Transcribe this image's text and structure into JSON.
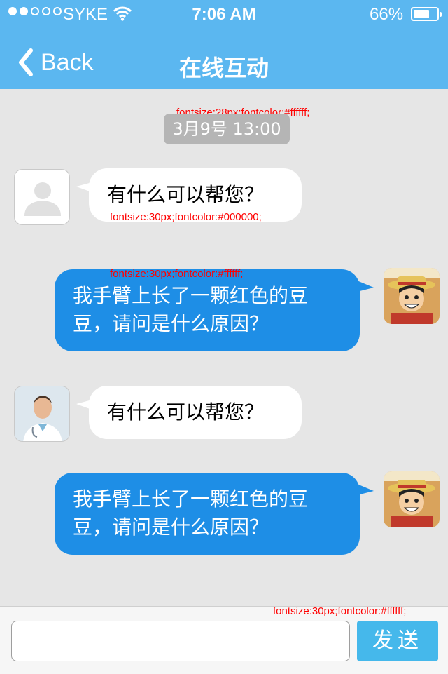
{
  "status_bar": {
    "carrier": "SYKE",
    "time": "7:06 AM",
    "battery": "66%",
    "battery_level": 0.66,
    "signal_bars": 2,
    "signal_max": 5
  },
  "nav": {
    "back_label": "Back",
    "title": "在线互动"
  },
  "annotations": {
    "timestamp_note": "fontsize:28px;fontcolor:#ffffff;",
    "incoming_note": "fontsize:30px;fontcolor:#000000;",
    "outgoing_note": "fontsize:30px;fontcolor:#ffffff;",
    "send_note": "fontsize:30px;fontcolor:#ffffff;"
  },
  "chat": {
    "timestamp": "3月9号 13:00",
    "messages": [
      {
        "direction": "incoming",
        "text": "有什么可以帮您？",
        "avatar": "user-placeholder-icon"
      },
      {
        "direction": "outgoing",
        "line1": "我手臂上长了一颗红色的豆",
        "line2": "豆，请问是什么原因？",
        "avatar": "anime-avatar"
      },
      {
        "direction": "incoming",
        "text": "有什么可以帮您？",
        "avatar": "doctor-avatar"
      },
      {
        "direction": "outgoing",
        "line1": "我手臂上长了一颗红色的豆",
        "line2": "豆，请问是什么原因？",
        "avatar": "anime-avatar"
      }
    ]
  },
  "composer": {
    "input_value": "",
    "send_label": "发送"
  },
  "colors": {
    "header": "#5bb7f0",
    "background": "#e6e6e6",
    "outgoing_bubble": "#1e8ee6",
    "incoming_bubble": "#ffffff",
    "send_button": "#45b8eb",
    "annotation": "#ff0000"
  }
}
